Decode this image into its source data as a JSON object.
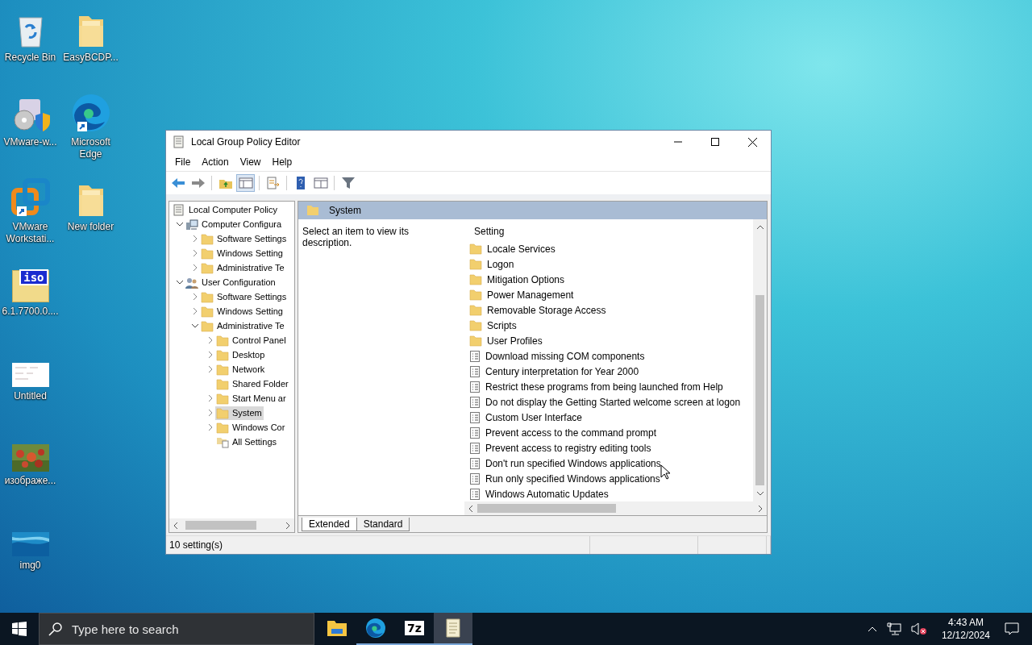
{
  "desktop": {
    "columns": [
      [
        {
          "label": "Recycle Bin",
          "kind": "recycle-bin",
          "shortcut": false
        },
        {
          "label": "VMware-w...",
          "kind": "installer",
          "shortcut": false
        },
        {
          "label": "VMware Workstati...",
          "kind": "vmware",
          "shortcut": true
        },
        {
          "label": "6.1.7700.0....",
          "kind": "iso",
          "badge": "iso",
          "shortcut": false
        },
        {
          "label": "Untitled",
          "kind": "document",
          "shortcut": false
        },
        {
          "label": "изображе...",
          "kind": "picture",
          "shortcut": false
        },
        {
          "label": "img0",
          "kind": "picture",
          "shortcut": false
        }
      ],
      [
        {
          "label": "EasyBCDP...",
          "kind": "folder",
          "shortcut": false
        },
        {
          "label": "Microsoft Edge",
          "kind": "edge",
          "shortcut": true
        },
        {
          "label": "New folder",
          "kind": "folder",
          "shortcut": false
        }
      ]
    ]
  },
  "window": {
    "title": "Local Group Policy Editor",
    "menu": [
      "File",
      "Action",
      "View",
      "Help"
    ],
    "toolbar": [
      {
        "kind": "back",
        "pressed": false
      },
      {
        "kind": "forward",
        "pressed": false
      },
      {
        "kind": "sep"
      },
      {
        "kind": "up",
        "pressed": false
      },
      {
        "kind": "tree",
        "pressed": true
      },
      {
        "kind": "sep"
      },
      {
        "kind": "export",
        "pressed": false
      },
      {
        "kind": "sep"
      },
      {
        "kind": "help",
        "pressed": false
      },
      {
        "kind": "properties",
        "pressed": false
      },
      {
        "kind": "sep"
      },
      {
        "kind": "filter",
        "pressed": false
      }
    ],
    "tree": [
      {
        "label": "Local Computer Policy",
        "kind": "policy",
        "selected": false,
        "children": [
          {
            "label": "Computer Configura",
            "kind": "computer",
            "expandable": true,
            "expanded": true,
            "selected": false,
            "children": [
              {
                "label": "Software Settings",
                "kind": "folder",
                "expandable": true,
                "expanded": false,
                "selected": false
              },
              {
                "label": "Windows Setting",
                "kind": "folder",
                "expandable": true,
                "expanded": false,
                "selected": false
              },
              {
                "label": "Administrative Te",
                "kind": "folder",
                "expandable": true,
                "expanded": false,
                "selected": false
              }
            ]
          },
          {
            "label": "User Configuration",
            "kind": "users",
            "expandable": true,
            "expanded": true,
            "selected": false,
            "children": [
              {
                "label": "Software Settings",
                "kind": "folder",
                "expandable": true,
                "expanded": false,
                "selected": false
              },
              {
                "label": "Windows Setting",
                "kind": "folder",
                "expandable": true,
                "expanded": false,
                "selected": false
              },
              {
                "label": "Administrative Te",
                "kind": "folder",
                "expandable": true,
                "expanded": true,
                "selected": false,
                "children": [
                  {
                    "label": "Control Panel",
                    "kind": "folder",
                    "expandable": true,
                    "expanded": false,
                    "selected": false
                  },
                  {
                    "label": "Desktop",
                    "kind": "folder",
                    "expandable": true,
                    "expanded": false,
                    "selected": false
                  },
                  {
                    "label": "Network",
                    "kind": "folder",
                    "expandable": true,
                    "expanded": false,
                    "selected": false
                  },
                  {
                    "label": "Shared Folder",
                    "kind": "folder",
                    "expandable": false,
                    "expanded": false,
                    "selected": false
                  },
                  {
                    "label": "Start Menu ar",
                    "kind": "folder",
                    "expandable": true,
                    "expanded": false,
                    "selected": false
                  },
                  {
                    "label": "System",
                    "kind": "folder",
                    "expandable": true,
                    "expanded": false,
                    "selected": true
                  },
                  {
                    "label": "Windows Cor",
                    "kind": "folder",
                    "expandable": true,
                    "expanded": false,
                    "selected": false
                  },
                  {
                    "label": "All Settings",
                    "kind": "all-settings",
                    "expandable": false,
                    "expanded": false,
                    "selected": false
                  }
                ]
              }
            ]
          }
        ]
      }
    ],
    "panel": {
      "title": "System",
      "description": "Select an item to view its description.",
      "column": "Setting",
      "items": [
        {
          "label": "Locale Services",
          "kind": "folder"
        },
        {
          "label": "Logon",
          "kind": "folder"
        },
        {
          "label": "Mitigation Options",
          "kind": "folder"
        },
        {
          "label": "Power Management",
          "kind": "folder"
        },
        {
          "label": "Removable Storage Access",
          "kind": "folder"
        },
        {
          "label": "Scripts",
          "kind": "folder"
        },
        {
          "label": "User Profiles",
          "kind": "folder"
        },
        {
          "label": "Download missing COM components",
          "kind": "setting"
        },
        {
          "label": "Century interpretation for Year 2000",
          "kind": "setting"
        },
        {
          "label": "Restrict these programs from being launched from Help",
          "kind": "setting"
        },
        {
          "label": "Do not display the Getting Started welcome screen at logon",
          "kind": "setting"
        },
        {
          "label": "Custom User Interface",
          "kind": "setting"
        },
        {
          "label": "Prevent access to the command prompt",
          "kind": "setting"
        },
        {
          "label": "Prevent access to registry editing tools",
          "kind": "setting"
        },
        {
          "label": "Don't run specified Windows applications",
          "kind": "setting"
        },
        {
          "label": "Run only specified Windows applications",
          "kind": "setting"
        },
        {
          "label": "Windows Automatic Updates",
          "kind": "setting"
        }
      ],
      "tabs": [
        {
          "label": "Extended",
          "selected": true
        },
        {
          "label": "Standard",
          "selected": false
        }
      ]
    },
    "status_bar": "10 setting(s)"
  },
  "taskbar": {
    "search": {
      "placeholder": "Type here to search"
    },
    "apps": [
      {
        "kind": "explorer",
        "running": false,
        "selected": false
      },
      {
        "kind": "edge",
        "running": true,
        "selected": false
      },
      {
        "kind": "archiver",
        "text": "7z",
        "running": true,
        "selected": false
      },
      {
        "kind": "notepad",
        "running": true,
        "selected": true
      }
    ],
    "time": "4:43 AM",
    "date": "12/12/2024"
  }
}
